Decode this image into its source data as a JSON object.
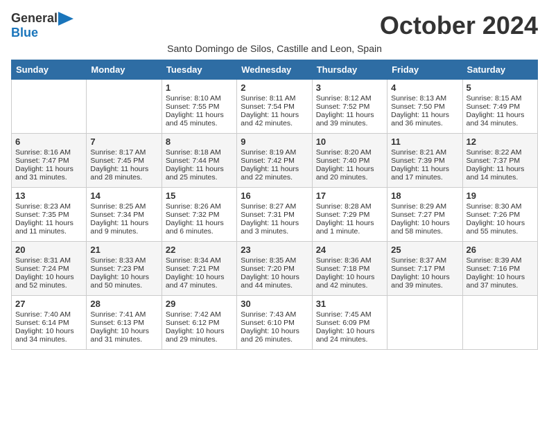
{
  "logo": {
    "general": "General",
    "blue": "Blue",
    "icon": "▶"
  },
  "title": "October 2024",
  "subtitle": "Santo Domingo de Silos, Castille and Leon, Spain",
  "days_of_week": [
    "Sunday",
    "Monday",
    "Tuesday",
    "Wednesday",
    "Thursday",
    "Friday",
    "Saturday"
  ],
  "weeks": [
    [
      {
        "day": "",
        "sunrise": "",
        "sunset": "",
        "daylight": ""
      },
      {
        "day": "",
        "sunrise": "",
        "sunset": "",
        "daylight": ""
      },
      {
        "day": "1",
        "sunrise": "Sunrise: 8:10 AM",
        "sunset": "Sunset: 7:55 PM",
        "daylight": "Daylight: 11 hours and 45 minutes."
      },
      {
        "day": "2",
        "sunrise": "Sunrise: 8:11 AM",
        "sunset": "Sunset: 7:54 PM",
        "daylight": "Daylight: 11 hours and 42 minutes."
      },
      {
        "day": "3",
        "sunrise": "Sunrise: 8:12 AM",
        "sunset": "Sunset: 7:52 PM",
        "daylight": "Daylight: 11 hours and 39 minutes."
      },
      {
        "day": "4",
        "sunrise": "Sunrise: 8:13 AM",
        "sunset": "Sunset: 7:50 PM",
        "daylight": "Daylight: 11 hours and 36 minutes."
      },
      {
        "day": "5",
        "sunrise": "Sunrise: 8:15 AM",
        "sunset": "Sunset: 7:49 PM",
        "daylight": "Daylight: 11 hours and 34 minutes."
      }
    ],
    [
      {
        "day": "6",
        "sunrise": "Sunrise: 8:16 AM",
        "sunset": "Sunset: 7:47 PM",
        "daylight": "Daylight: 11 hours and 31 minutes."
      },
      {
        "day": "7",
        "sunrise": "Sunrise: 8:17 AM",
        "sunset": "Sunset: 7:45 PM",
        "daylight": "Daylight: 11 hours and 28 minutes."
      },
      {
        "day": "8",
        "sunrise": "Sunrise: 8:18 AM",
        "sunset": "Sunset: 7:44 PM",
        "daylight": "Daylight: 11 hours and 25 minutes."
      },
      {
        "day": "9",
        "sunrise": "Sunrise: 8:19 AM",
        "sunset": "Sunset: 7:42 PM",
        "daylight": "Daylight: 11 hours and 22 minutes."
      },
      {
        "day": "10",
        "sunrise": "Sunrise: 8:20 AM",
        "sunset": "Sunset: 7:40 PM",
        "daylight": "Daylight: 11 hours and 20 minutes."
      },
      {
        "day": "11",
        "sunrise": "Sunrise: 8:21 AM",
        "sunset": "Sunset: 7:39 PM",
        "daylight": "Daylight: 11 hours and 17 minutes."
      },
      {
        "day": "12",
        "sunrise": "Sunrise: 8:22 AM",
        "sunset": "Sunset: 7:37 PM",
        "daylight": "Daylight: 11 hours and 14 minutes."
      }
    ],
    [
      {
        "day": "13",
        "sunrise": "Sunrise: 8:23 AM",
        "sunset": "Sunset: 7:35 PM",
        "daylight": "Daylight: 11 hours and 11 minutes."
      },
      {
        "day": "14",
        "sunrise": "Sunrise: 8:25 AM",
        "sunset": "Sunset: 7:34 PM",
        "daylight": "Daylight: 11 hours and 9 minutes."
      },
      {
        "day": "15",
        "sunrise": "Sunrise: 8:26 AM",
        "sunset": "Sunset: 7:32 PM",
        "daylight": "Daylight: 11 hours and 6 minutes."
      },
      {
        "day": "16",
        "sunrise": "Sunrise: 8:27 AM",
        "sunset": "Sunset: 7:31 PM",
        "daylight": "Daylight: 11 hours and 3 minutes."
      },
      {
        "day": "17",
        "sunrise": "Sunrise: 8:28 AM",
        "sunset": "Sunset: 7:29 PM",
        "daylight": "Daylight: 11 hours and 1 minute."
      },
      {
        "day": "18",
        "sunrise": "Sunrise: 8:29 AM",
        "sunset": "Sunset: 7:27 PM",
        "daylight": "Daylight: 10 hours and 58 minutes."
      },
      {
        "day": "19",
        "sunrise": "Sunrise: 8:30 AM",
        "sunset": "Sunset: 7:26 PM",
        "daylight": "Daylight: 10 hours and 55 minutes."
      }
    ],
    [
      {
        "day": "20",
        "sunrise": "Sunrise: 8:31 AM",
        "sunset": "Sunset: 7:24 PM",
        "daylight": "Daylight: 10 hours and 52 minutes."
      },
      {
        "day": "21",
        "sunrise": "Sunrise: 8:33 AM",
        "sunset": "Sunset: 7:23 PM",
        "daylight": "Daylight: 10 hours and 50 minutes."
      },
      {
        "day": "22",
        "sunrise": "Sunrise: 8:34 AM",
        "sunset": "Sunset: 7:21 PM",
        "daylight": "Daylight: 10 hours and 47 minutes."
      },
      {
        "day": "23",
        "sunrise": "Sunrise: 8:35 AM",
        "sunset": "Sunset: 7:20 PM",
        "daylight": "Daylight: 10 hours and 44 minutes."
      },
      {
        "day": "24",
        "sunrise": "Sunrise: 8:36 AM",
        "sunset": "Sunset: 7:18 PM",
        "daylight": "Daylight: 10 hours and 42 minutes."
      },
      {
        "day": "25",
        "sunrise": "Sunrise: 8:37 AM",
        "sunset": "Sunset: 7:17 PM",
        "daylight": "Daylight: 10 hours and 39 minutes."
      },
      {
        "day": "26",
        "sunrise": "Sunrise: 8:39 AM",
        "sunset": "Sunset: 7:16 PM",
        "daylight": "Daylight: 10 hours and 37 minutes."
      }
    ],
    [
      {
        "day": "27",
        "sunrise": "Sunrise: 7:40 AM",
        "sunset": "Sunset: 6:14 PM",
        "daylight": "Daylight: 10 hours and 34 minutes."
      },
      {
        "day": "28",
        "sunrise": "Sunrise: 7:41 AM",
        "sunset": "Sunset: 6:13 PM",
        "daylight": "Daylight: 10 hours and 31 minutes."
      },
      {
        "day": "29",
        "sunrise": "Sunrise: 7:42 AM",
        "sunset": "Sunset: 6:12 PM",
        "daylight": "Daylight: 10 hours and 29 minutes."
      },
      {
        "day": "30",
        "sunrise": "Sunrise: 7:43 AM",
        "sunset": "Sunset: 6:10 PM",
        "daylight": "Daylight: 10 hours and 26 minutes."
      },
      {
        "day": "31",
        "sunrise": "Sunrise: 7:45 AM",
        "sunset": "Sunset: 6:09 PM",
        "daylight": "Daylight: 10 hours and 24 minutes."
      },
      {
        "day": "",
        "sunrise": "",
        "sunset": "",
        "daylight": ""
      },
      {
        "day": "",
        "sunrise": "",
        "sunset": "",
        "daylight": ""
      }
    ]
  ],
  "row_colors": [
    "normal",
    "alt",
    "normal",
    "alt",
    "normal"
  ]
}
